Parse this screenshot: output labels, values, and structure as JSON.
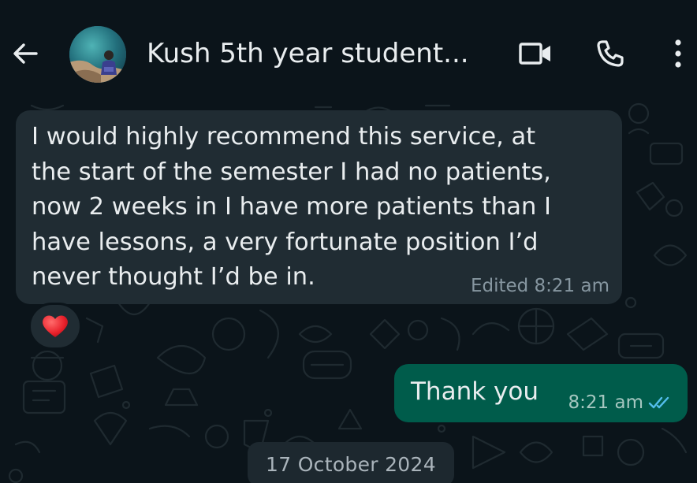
{
  "header": {
    "contact_name": "Kush 5th year student...",
    "back_icon": "arrow-left-icon",
    "video_icon": "video-call-icon",
    "phone_icon": "phone-icon",
    "menu_icon": "more-vertical-icon"
  },
  "messages": {
    "incoming": {
      "text": "I would highly recommend this service, at\nthe start of the semester I had no patients,\nnow 2 weeks in I have more patients than I\nhave lessons, a very fortunate position I’d\nnever thought I’d be in.",
      "meta": "Edited 8:21 am",
      "reaction": "❤️"
    },
    "outgoing": {
      "text": "Thank you",
      "time": "8:21 am",
      "status_icon": "double-check-read-icon"
    }
  },
  "date_chip": "17 October 2024",
  "colors": {
    "background": "#0b141a",
    "incoming_bubble": "#202c33",
    "outgoing_bubble": "#005c4b",
    "read_ticks": "#53bdeb",
    "text": "#e9edef",
    "meta_text": "#8696a0"
  }
}
